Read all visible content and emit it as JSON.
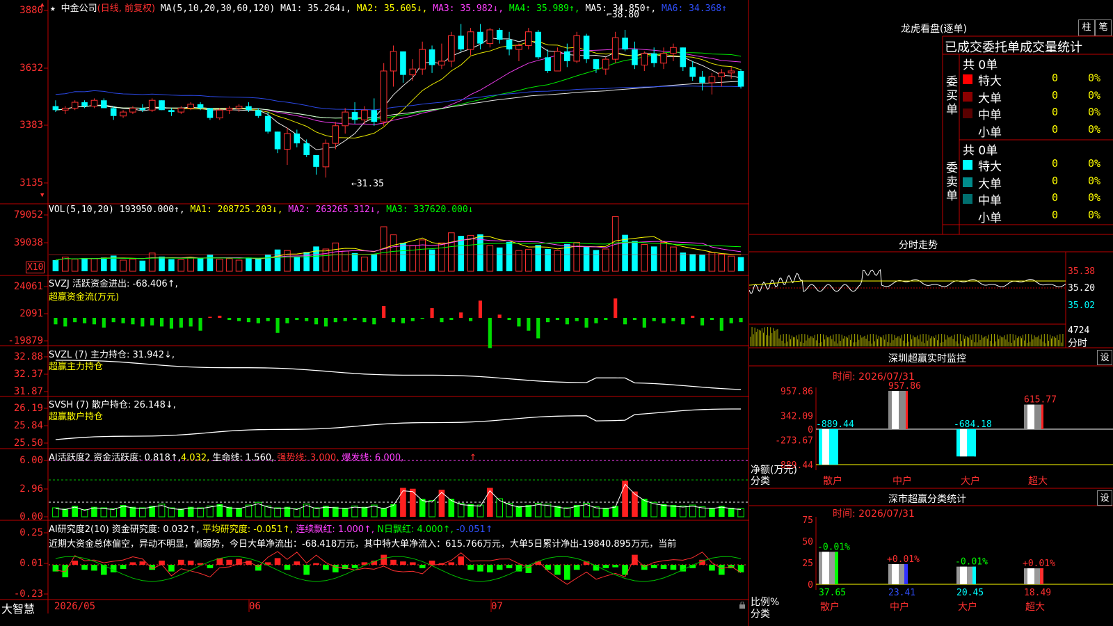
{
  "chart_data": {
    "type": "candlestick",
    "title": "中金公司",
    "subtitle": "(日线, 前复权)",
    "x_tick_labels": [
      "2026/05",
      "06",
      "07"
    ],
    "y_ticks": [
      "3880",
      "3632",
      "3383",
      "3135"
    ],
    "annotations": [
      "38.80",
      "31.35"
    ],
    "candles_ohlc": [
      [
        35.0,
        35.3,
        34.7,
        34.8
      ],
      [
        34.8,
        35.0,
        34.6,
        34.9
      ],
      [
        34.9,
        35.3,
        34.8,
        35.2
      ],
      [
        35.2,
        35.3,
        34.9,
        35.0
      ],
      [
        35.0,
        35.4,
        34.9,
        35.3
      ],
      [
        35.3,
        35.4,
        34.9,
        34.9
      ],
      [
        34.9,
        35.0,
        34.3,
        34.5
      ],
      [
        34.5,
        34.8,
        34.4,
        34.7
      ],
      [
        34.7,
        35.0,
        34.6,
        34.9
      ],
      [
        34.9,
        35.1,
        34.7,
        34.8
      ],
      [
        34.8,
        35.4,
        34.7,
        35.3
      ],
      [
        35.3,
        35.3,
        34.8,
        34.8
      ],
      [
        34.8,
        34.9,
        34.5,
        34.7
      ],
      [
        34.7,
        35.0,
        34.6,
        34.9
      ],
      [
        34.9,
        35.2,
        34.8,
        35.1
      ],
      [
        35.1,
        35.2,
        34.8,
        34.9
      ],
      [
        34.9,
        34.9,
        34.3,
        34.4
      ],
      [
        34.4,
        34.9,
        34.3,
        34.8
      ],
      [
        34.8,
        35.0,
        34.6,
        34.9
      ],
      [
        34.9,
        35.1,
        34.7,
        35.0
      ],
      [
        35.0,
        35.2,
        34.7,
        34.8
      ],
      [
        34.8,
        34.9,
        34.4,
        34.5
      ],
      [
        34.5,
        34.7,
        33.6,
        33.7
      ],
      [
        33.7,
        33.7,
        32.6,
        32.8
      ],
      [
        32.8,
        33.9,
        32.0,
        33.6
      ],
      [
        33.6,
        33.8,
        32.9,
        33.1
      ],
      [
        33.1,
        33.3,
        32.4,
        32.5
      ],
      [
        32.5,
        32.5,
        31.5,
        31.9
      ],
      [
        31.9,
        33.3,
        31.35,
        33.1
      ],
      [
        33.1,
        34.2,
        32.8,
        34.0
      ],
      [
        34.0,
        34.9,
        33.6,
        34.7
      ],
      [
        34.7,
        35.2,
        34.1,
        34.3
      ],
      [
        34.3,
        35.0,
        34.1,
        34.8
      ],
      [
        34.8,
        35.4,
        34.0,
        34.2
      ],
      [
        34.2,
        37.2,
        34.0,
        36.8
      ],
      [
        36.8,
        38.1,
        36.0,
        37.8
      ],
      [
        37.8,
        37.8,
        36.2,
        36.6
      ],
      [
        36.6,
        37.4,
        36.3,
        36.9
      ],
      [
        36.9,
        38.3,
        36.6,
        37.9
      ],
      [
        37.9,
        38.1,
        36.7,
        37.1
      ],
      [
        37.1,
        38.2,
        36.9,
        37.3
      ],
      [
        37.3,
        38.8,
        37.0,
        38.6
      ],
      [
        38.6,
        39.2,
        37.8,
        37.9
      ],
      [
        37.9,
        39.0,
        37.6,
        38.8
      ],
      [
        38.8,
        39.2,
        37.9,
        38.2
      ],
      [
        38.2,
        39.0,
        38.0,
        38.9
      ],
      [
        38.9,
        39.0,
        38.2,
        38.4
      ],
      [
        38.4,
        38.8,
        37.6,
        37.9
      ],
      [
        37.9,
        38.2,
        37.3,
        38.1
      ],
      [
        38.1,
        39.0,
        37.9,
        38.8
      ],
      [
        38.8,
        38.9,
        37.4,
        37.5
      ],
      [
        37.5,
        37.9,
        36.7,
        36.8
      ],
      [
        36.8,
        38.0,
        36.8,
        37.8
      ],
      [
        37.8,
        38.2,
        37.0,
        37.3
      ],
      [
        37.3,
        38.8,
        37.2,
        38.6
      ],
      [
        38.6,
        38.7,
        37.2,
        37.4
      ],
      [
        37.4,
        37.4,
        36.7,
        36.9
      ],
      [
        36.9,
        37.5,
        36.6,
        37.4
      ],
      [
        37.4,
        38.8,
        37.2,
        38.5
      ],
      [
        38.5,
        38.9,
        37.8,
        37.9
      ],
      [
        37.9,
        38.3,
        36.9,
        37.1
      ],
      [
        37.1,
        37.8,
        36.8,
        37.7
      ],
      [
        37.7,
        38.0,
        37.0,
        37.2
      ],
      [
        37.2,
        38.0,
        36.9,
        37.7
      ],
      [
        37.7,
        38.2,
        37.3,
        38.0
      ],
      [
        38.0,
        38.0,
        36.8,
        37.0
      ],
      [
        37.0,
        37.3,
        36.3,
        36.5
      ],
      [
        36.5,
        36.8,
        35.8,
        36.2
      ],
      [
        36.2,
        36.7,
        35.6,
        36.5
      ],
      [
        36.5,
        36.9,
        36.0,
        36.7
      ],
      [
        36.7,
        37.0,
        36.4,
        36.8
      ],
      [
        36.8,
        36.9,
        35.9,
        36.0
      ]
    ],
    "volume_bars": [
      22,
      28,
      24,
      26,
      25,
      27,
      31,
      22,
      24,
      21,
      36,
      29,
      24,
      23,
      27,
      26,
      33,
      24,
      25,
      22,
      27,
      25,
      33,
      43,
      41,
      29,
      38,
      49,
      44,
      56,
      40,
      36,
      28,
      34,
      88,
      72,
      56,
      51,
      62,
      43,
      56,
      76,
      70,
      71,
      73,
      51,
      47,
      58,
      41,
      43,
      52,
      44,
      41,
      54,
      57,
      49,
      42,
      44,
      108,
      72,
      60,
      53,
      49,
      57,
      48,
      37,
      34,
      33,
      37,
      34,
      30,
      28
    ],
    "active_money_bars": [
      -6,
      -8,
      -4,
      -5,
      -6,
      -9,
      -4,
      -5,
      -6,
      -8,
      -7,
      -8,
      -10,
      -9,
      -8,
      -12,
      1,
      2,
      -2,
      -3,
      -4,
      -5,
      -3,
      -14,
      -5,
      -2,
      -3,
      -6,
      -8,
      -4,
      -3,
      -2,
      -4,
      -6,
      11,
      -4,
      -5,
      -3,
      -1,
      9,
      -4,
      -2,
      5,
      -3,
      16,
      -28,
      3,
      -2,
      -8,
      -12,
      -19,
      -4,
      -2,
      -6,
      -3,
      -9,
      -5,
      -2,
      18,
      -6,
      -2,
      -9,
      -3,
      -5,
      -3,
      -6,
      2,
      -7,
      -2,
      -12,
      -5,
      -4,
      -3
    ],
    "money_bar_colors": [
      "down",
      "down",
      "down",
      "down",
      "down",
      "down",
      "down",
      "down",
      "down",
      "down",
      "down",
      "down",
      "down",
      "down",
      "down",
      "down",
      "up",
      "up",
      "down",
      "down",
      "down",
      "down",
      "down",
      "down",
      "down",
      "down",
      "down",
      "down",
      "down",
      "down",
      "down",
      "down",
      "down",
      "down",
      "up",
      "down",
      "down",
      "down",
      "down",
      "up",
      "down",
      "down",
      "up",
      "down",
      "up",
      "down",
      "up",
      "down",
      "down",
      "down",
      "down",
      "down",
      "down",
      "down",
      "down",
      "down",
      "down",
      "down",
      "up",
      "down",
      "down",
      "down",
      "down",
      "down",
      "down",
      "down",
      "up",
      "down",
      "down",
      "down",
      "down",
      "down",
      "down"
    ],
    "active_level": [
      1.0,
      0.9,
      1.2,
      0.8,
      1.1,
      1.0,
      0.9,
      1.3,
      1.1,
      1.0,
      1.2,
      1.4,
      1.0,
      0.9,
      1.1,
      1.0,
      1.2,
      1.4,
      1.1,
      1.0,
      1.3,
      1.6,
      1.2,
      1.0,
      1.1,
      0.9,
      1.4,
      1.0,
      1.2,
      1.1,
      1.0,
      1.2,
      1.1,
      1.3,
      1.0,
      1.4,
      3.2,
      3.1,
      2.0,
      1.8,
      3.0,
      2.0,
      1.5,
      1.4,
      1.3,
      3.2,
      2.0,
      1.5,
      1.2,
      1.3,
      1.5,
      1.4,
      1.2,
      1.0,
      1.3,
      1.5,
      1.1,
      1.0,
      1.2,
      4.0,
      2.8,
      2.0,
      1.6,
      1.4,
      1.3,
      1.2,
      1.3,
      1.1,
      1.0,
      1.2,
      1.0,
      0.9,
      1.0,
      1.2
    ],
    "research_bars": [
      -0.08,
      -0.15,
      0.05,
      -0.06,
      -0.07,
      -0.12,
      -0.09,
      -0.05,
      0.03,
      0.04,
      -0.06,
      0.05,
      -0.08,
      0.06,
      0.05,
      0.02,
      -0.04,
      0.08,
      0.06,
      0.07,
      0.05,
      -0.07,
      0.03,
      0.08,
      -0.06,
      0.04,
      -0.12,
      0.02,
      -0.06,
      -0.09,
      -0.05,
      -0.04,
      0.03,
      0.05,
      0.12,
      0.06,
      0.04,
      0.03,
      -0.04,
      0.05,
      0.02,
      0.03,
      0.1,
      -0.06,
      -0.08,
      -0.09,
      -0.06,
      -0.04,
      -0.08,
      -0.1,
      0.04,
      -0.06,
      -0.12,
      -0.18,
      -0.06,
      0.04,
      -0.07,
      -0.04,
      -0.03,
      -0.12,
      0.12,
      -0.06,
      -0.04,
      -0.05,
      -0.06,
      -0.08,
      -0.04,
      0.06,
      -0.07,
      -0.12,
      -0.04,
      -0.09,
      -0.06,
      -0.12,
      -0.05,
      0.05
    ]
  },
  "header": {
    "star": "★",
    "stock_name": "中金公司",
    "mode": "(日线, 前复权)",
    "ma_label": "MA(5,10,20,30,60,120)",
    "ma1": "MA1: 35.264↓,",
    "ma2": "MA2: 35.605↓,",
    "ma3": "MA3: 35.982↓,",
    "ma4": "MA4: 35.989↑,",
    "ma5": "MA5: 34.850↑,",
    "ma6": "MA6: 34.368↑"
  },
  "vol": {
    "title": "VOL(5,10,20)",
    "value": "193950.000↑,",
    "ma1": "MA1: 208725.203↓,",
    "ma2": "MA2: 263265.312↓,",
    "ma3": "MA3: 337620.000↓",
    "y_ticks": [
      "79052",
      "39038"
    ],
    "unit": "X10"
  },
  "svzj": {
    "title": "SVZJ  活跃资金进出: -68.406↑,",
    "subtitle": "超赢资金流(万元)",
    "y_ticks": [
      "24061",
      "2091",
      "-19879"
    ]
  },
  "svzl": {
    "title": "SVZL (7) 主力持仓: 31.942↓,",
    "subtitle": "超赢主力持仓",
    "y_ticks": [
      "32.88",
      "32.37",
      "31.87"
    ]
  },
  "svsh": {
    "title": "SVSH (7) 散户持仓: 26.148↓,",
    "subtitle": "超赢散户持仓",
    "y_ticks": [
      "26.19",
      "25.84",
      "25.50"
    ]
  },
  "ai_active": {
    "title_a": "AI活跃度2 资金活跃度: 0.818↑,",
    "title_b": "4.032,",
    "title_c": "生命线: 1.560,",
    "title_d": "强势线: 3.000,",
    "title_e": "爆发线: 6.000,",
    "title_f": "↑",
    "y_ticks": [
      "6.00",
      "2.96",
      "0.00"
    ]
  },
  "ai_research": {
    "title_a": "AI研究度2(10) 资金研究度: 0.032↑,",
    "title_b": "平均研究度: -0.051↑,",
    "title_c": "连续飘红: 1.000↑,",
    "title_d": "N日飘红: 4.000↑,",
    "title_e": "-0.051↑",
    "comment": "近期大资金总体偏空，异动不明显，偏弱势，今日大单净流出：-68.418万元，其中特大单净流入：615.766万元，大单5日累计净出-19840.895万元，当前",
    "y_ticks": [
      "0.25",
      "0.01",
      "-0.23"
    ]
  },
  "footer": {
    "brand": "大智慧",
    "dates": [
      "2026/05",
      "06",
      "07"
    ]
  },
  "right": {
    "longhu_title": "龙虎看盘(逐单)",
    "btn_zhu": "柱",
    "btn_bi": "笔",
    "stats_title": "已成交委托单成交量统计",
    "buy_label": "委买单",
    "sell_label": "委卖单",
    "buy_total": "共 0单",
    "sell_total": "共 0单",
    "buy_rows": [
      {
        "name": "特大",
        "count": "0",
        "pct": "0%",
        "color": "#ff0000"
      },
      {
        "name": "大单",
        "count": "0",
        "pct": "0%",
        "color": "#8b0000"
      },
      {
        "name": "中单",
        "count": "0",
        "pct": "0%",
        "color": "#5a0000"
      },
      {
        "name": "小单",
        "count": "0",
        "pct": "0%",
        "color": "#000000"
      }
    ],
    "sell_rows": [
      {
        "name": "特大",
        "count": "0",
        "pct": "0%",
        "color": "#00ffff"
      },
      {
        "name": "大单",
        "count": "0",
        "pct": "0%",
        "color": "#008b8b"
      },
      {
        "name": "中单",
        "count": "0",
        "pct": "0%",
        "color": "#007070"
      },
      {
        "name": "小单",
        "count": "0",
        "pct": "0%",
        "color": "#000000"
      }
    ],
    "fenshi_title": "分时走势",
    "fenshi_y": [
      "35.38",
      "35.20",
      "35.02"
    ],
    "fenshi_vol": "4724",
    "fenshi_label": "分时",
    "sz_monitor_title": "深圳超赢实时监控",
    "sz_settings": "设",
    "sz_time": "时间: 2026/07/31",
    "sz_y": [
      "957.86",
      "342.09",
      "0",
      "-273.67",
      "-889.44"
    ],
    "sz_ylabel": "净额(万元)",
    "sz_cat_label": "分类",
    "sz_bars": [
      {
        "cat": "散户",
        "value": "-889.44",
        "num": -889.44
      },
      {
        "cat": "中户",
        "value": "957.86",
        "num": 957.86
      },
      {
        "cat": "大户",
        "value": "-684.18",
        "num": -684.18
      },
      {
        "cat": "超大",
        "value": "615.77",
        "num": 615.77
      }
    ],
    "cls_title": "深市超赢分类统计",
    "cls_settings": "设",
    "cls_time": "时间: 2026/07/31",
    "cls_y": [
      "75",
      "50",
      "25",
      "0"
    ],
    "cls_ylabel": "比例%",
    "cls_cat_label": "分类",
    "cls_bars": [
      {
        "cat": "散户",
        "value": "37.65",
        "change": "-0.01%",
        "num": 37.65,
        "color": "#00ff00"
      },
      {
        "cat": "中户",
        "value": "23.41",
        "change": "+0.01%",
        "num": 23.41,
        "color": "#3030ff"
      },
      {
        "cat": "大户",
        "value": "20.45",
        "change": "-0.01%",
        "num": 20.45,
        "color": "#00ffff"
      },
      {
        "cat": "超大",
        "value": "18.49",
        "change": "+0.01%",
        "num": 18.49,
        "color": "#ff3030"
      }
    ]
  }
}
